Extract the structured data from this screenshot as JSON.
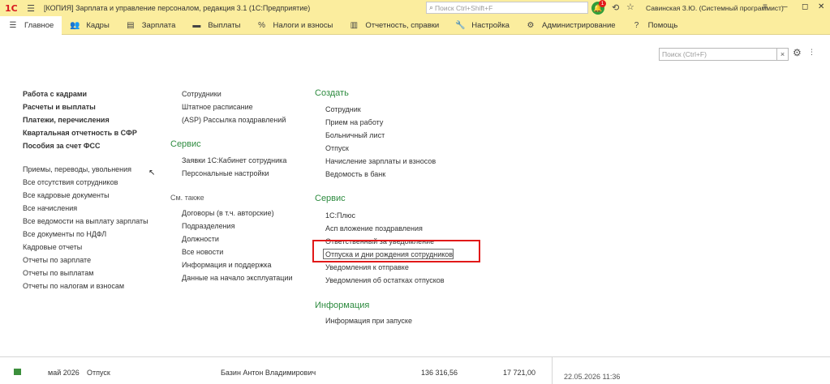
{
  "titlebar": {
    "app_title": "[КОПИЯ] Зарплата и управление персоналом, редакция 3.1  (1С:Предприятие)",
    "search_placeholder": "Поиск Ctrl+Shift+F",
    "notification_count": "1",
    "user": "Савинская З.Ю. (Системный программист)"
  },
  "sections": [
    {
      "label": "Главное",
      "icon": "menu-lines-icon",
      "active": true
    },
    {
      "label": "Кадры",
      "icon": "people-icon"
    },
    {
      "label": "Зарплата",
      "icon": "document-icon"
    },
    {
      "label": "Выплаты",
      "icon": "wallet-icon"
    },
    {
      "label": "Налоги и взносы",
      "icon": "percent-icon"
    },
    {
      "label": "Отчетность, справки",
      "icon": "report-icon"
    },
    {
      "label": "Настройка",
      "icon": "wrench-icon"
    },
    {
      "label": "Администрирование",
      "icon": "gear-icon"
    },
    {
      "label": "Помощь",
      "icon": "help-icon"
    }
  ],
  "content_search": {
    "placeholder": "Поиск (Ctrl+F)"
  },
  "col1": {
    "bold_links": [
      "Работа с кадрами",
      "Расчеты и выплаты",
      "Платежи, перечисления",
      "Квартальная отчетность в СФР",
      "Пособия за счет ФСС"
    ],
    "links": [
      "Приемы, переводы, увольнения",
      "Все отсутствия сотрудников",
      "Все кадровые документы",
      "Все начисления",
      "Все ведомости на выплату зарплаты",
      "Все документы по НДФЛ",
      "Кадровые отчеты",
      "Отчеты по зарплате",
      "Отчеты по выплатам",
      "Отчеты по налогам и взносам"
    ]
  },
  "col2": {
    "links_top": [
      "Сотрудники",
      "Штатное расписание",
      "(ASP) Рассылка поздравлений"
    ],
    "service_heading": "Сервис",
    "service_links": [
      "Заявки 1С:Кабинет сотрудника",
      "Персональные настройки"
    ],
    "see_also_heading": "См. также",
    "see_also_links": [
      "Договоры (в т.ч. авторские)",
      "Подразделения",
      "Должности",
      "Все новости",
      "Информация и поддержка",
      "Данные на начало эксплуатации"
    ]
  },
  "col3": {
    "create_heading": "Создать",
    "create_links": [
      "Сотрудник",
      "Прием на работу",
      "Больничный лист",
      "Отпуск",
      "Начисление зарплаты и взносов",
      "Ведомость в банк"
    ],
    "service_heading": "Сервис",
    "service_links": [
      "1С:Плюс",
      "Асп вложение поздравления",
      "Ответственный за уведомление",
      "Отпуска и дни рождения сотрудников",
      "Уведомления к отправке",
      "Уведомления об остатках отпусков"
    ],
    "info_heading": "Информация",
    "info_links": [
      "Информация при запуске"
    ]
  },
  "bottom_row": {
    "month": "май 2026",
    "doc_type": "Отпуск",
    "employee": "Базин Антон Владимирович",
    "amount1": "136 316,56",
    "amount2": "17 721,00",
    "right_date": "22.05.2026 11:36"
  },
  "colors": {
    "section_bg": "#fbed9e",
    "heading_green": "#2d8b3f",
    "highlight_red": "#e11919"
  }
}
